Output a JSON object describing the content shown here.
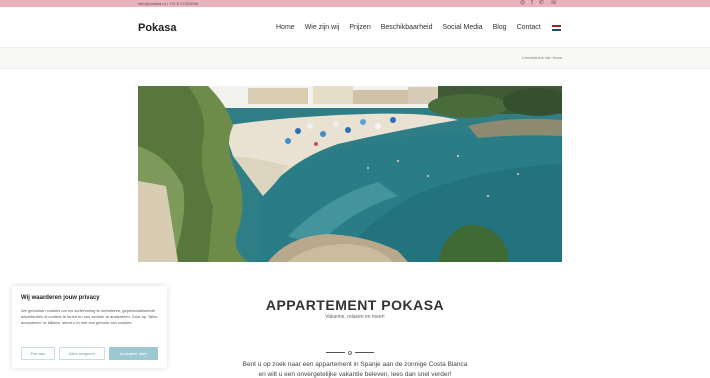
{
  "topbar": {
    "contact_text": "info@pokasa.nl | +31 6 17024098",
    "icons": [
      "instagram-icon",
      "facebook-icon",
      "whatsapp-icon",
      "phone-icon"
    ]
  },
  "header": {
    "logo": "Pokasa",
    "nav": [
      "Home",
      "Wie zijn wij",
      "Prijzen",
      "Beschikbaarheid",
      "Social Media",
      "Blog",
      "Contact"
    ],
    "language_flag": "nl-flag-icon"
  },
  "breadcrumb": "U bevindt zich hier: Home",
  "main": {
    "title": "APPARTEMENT POKASA",
    "subtitle": "Vakantie, relaxen en meer!",
    "intro_line1": "Bent u op zoek naar een appartement in Spanje aan de zonnige Costa Blanca",
    "intro_line2": "en wilt u een onvergetelijke vakantie beleven, lees dan snel verder!"
  },
  "cookie_banner": {
    "title": "Wij waarderen jouw privacy",
    "text": "We gebruiken cookies om uw surfervaring te verbeteren, gepersonaliseerde advertenties of content te tonen en ons verkeer te analyseren. Door op \"Alles accepteren\" te klikken, stemt u in met ons gebruik van cookies.",
    "buttons": {
      "customize": "Pas aan",
      "reject": "Alles weigeren",
      "accept": "Accepteer alles"
    }
  },
  "colors": {
    "topbar": "#e8b3bb",
    "accent": "#9cc9d1",
    "sea": "#2f7e86",
    "sand": "#e9e2d2"
  }
}
